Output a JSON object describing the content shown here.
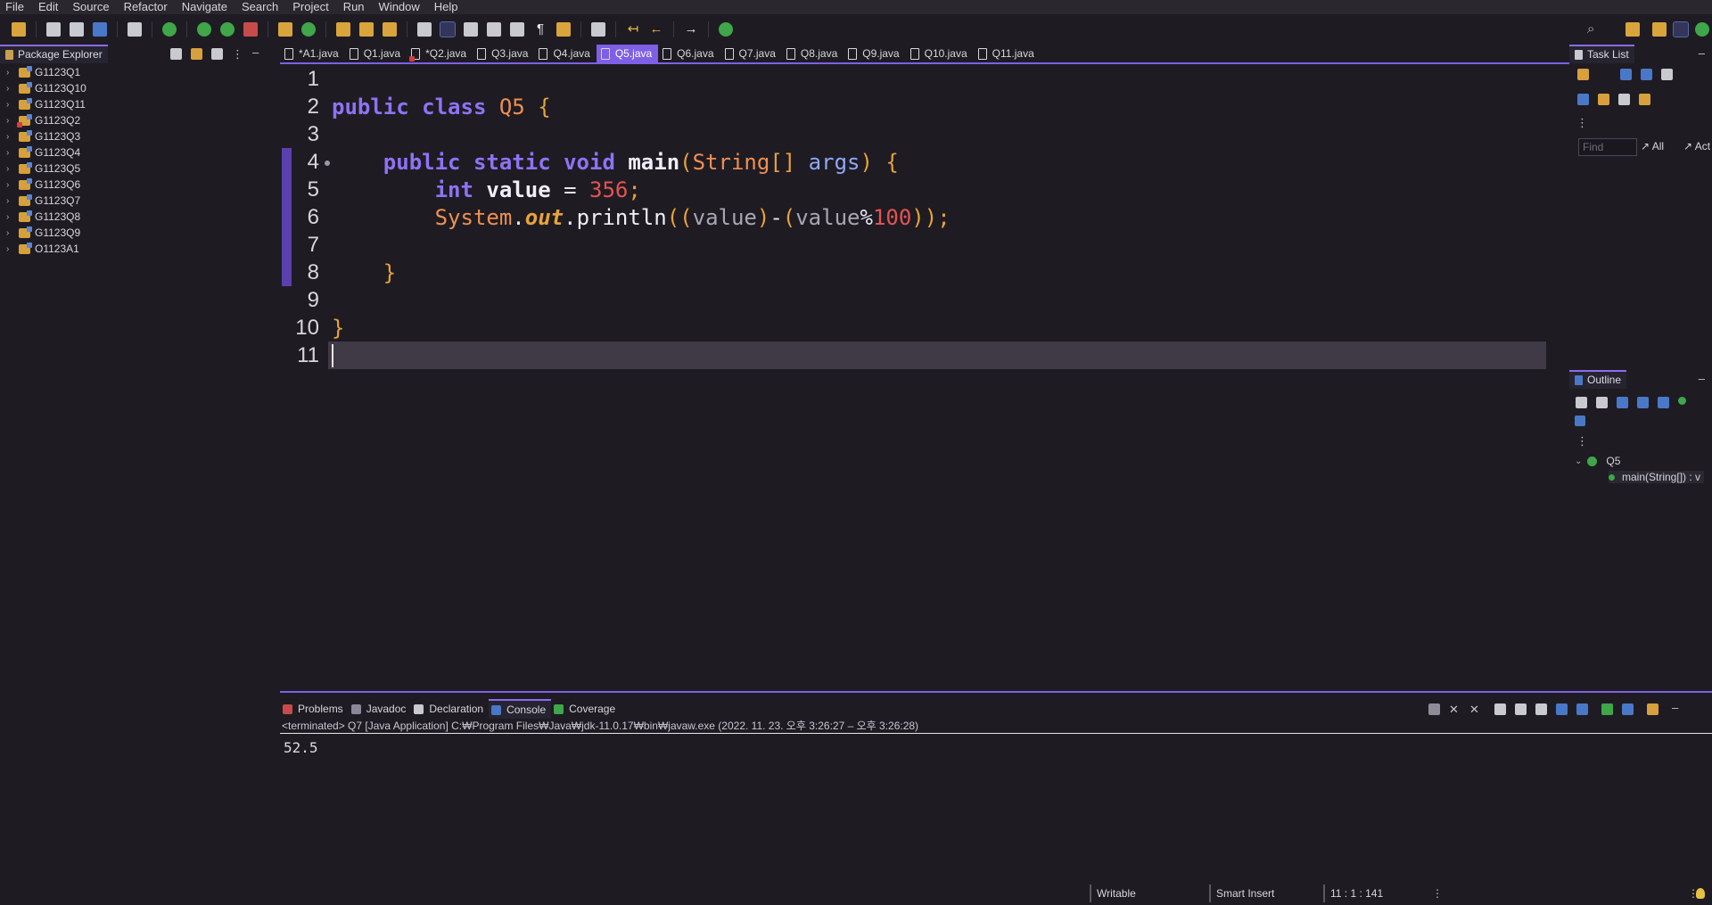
{
  "menu": [
    "File",
    "Edit",
    "Source",
    "Refactor",
    "Navigate",
    "Search",
    "Project",
    "Run",
    "Window",
    "Help"
  ],
  "package_explorer": {
    "title": "Package Explorer",
    "items": [
      {
        "label": "G1123Q1",
        "error": false
      },
      {
        "label": "G1123Q10",
        "error": false
      },
      {
        "label": "G1123Q11",
        "error": false
      },
      {
        "label": "G1123Q2",
        "error": true
      },
      {
        "label": "G1123Q3",
        "error": false
      },
      {
        "label": "G1123Q4",
        "error": false
      },
      {
        "label": "G1123Q5",
        "error": false
      },
      {
        "label": "G1123Q6",
        "error": false
      },
      {
        "label": "G1123Q7",
        "error": false
      },
      {
        "label": "G1123Q8",
        "error": false
      },
      {
        "label": "G1123Q9",
        "error": false
      },
      {
        "label": "O1123A1",
        "error": false
      }
    ]
  },
  "editor_tabs": [
    {
      "label": "*A1.java",
      "active": false,
      "error": false
    },
    {
      "label": "Q1.java",
      "active": false,
      "error": false
    },
    {
      "label": "*Q2.java",
      "active": false,
      "error": true
    },
    {
      "label": "Q3.java",
      "active": false,
      "error": false
    },
    {
      "label": "Q4.java",
      "active": false,
      "error": false
    },
    {
      "label": "Q5.java",
      "active": true,
      "error": false
    },
    {
      "label": "Q6.java",
      "active": false,
      "error": false
    },
    {
      "label": "Q7.java",
      "active": false,
      "error": false
    },
    {
      "label": "Q8.java",
      "active": false,
      "error": false
    },
    {
      "label": "Q9.java",
      "active": false,
      "error": false
    },
    {
      "label": "Q10.java",
      "active": false,
      "error": false
    },
    {
      "label": "Q11.java",
      "active": false,
      "error": false
    }
  ],
  "editor": {
    "line_numbers": [
      "1",
      "2",
      "3",
      "4",
      "5",
      "6",
      "7",
      "8",
      "9",
      "10",
      "11"
    ],
    "code": {
      "l2_kw1": "public",
      "l2_kw2": "class",
      "l2_cls": "Q5",
      "l2_br": "{",
      "l4_indent": "    ",
      "l4_kw1": "public",
      "l4_kw2": "static",
      "l4_kw3": "void",
      "l4_fn": "main",
      "l4_p1": "(",
      "l4_ty": "String",
      "l4_arr": "[]",
      "l4_pa": "args",
      "l4_p2": ")",
      "l4_br": "{",
      "l5_indent": "        ",
      "l5_ty": "int",
      "l5_var": "value",
      "l5_eq": " = ",
      "l5_num": "356",
      "l5_sc": ";",
      "l6_indent": "        ",
      "l6_sys": "System",
      "l6_dot1": ".",
      "l6_fld": "out",
      "l6_dot2": ".",
      "l6_fn": "println",
      "l6_o1": "((",
      "l6_v1": "value",
      "l6_c1": ")",
      "l6_minus": "-",
      "l6_o2": "(",
      "l6_v2": "value",
      "l6_mod": "%",
      "l6_num": "100",
      "l6_c2": "));",
      "l8_indent": "    ",
      "l8_br": "}",
      "l10_br": "}"
    }
  },
  "task_list": {
    "title": "Task List",
    "find_placeholder": "Find",
    "all_label": "All",
    "act_label": "Act"
  },
  "outline": {
    "title": "Outline",
    "class_name": "Q5",
    "method": "main(String[]) : v"
  },
  "console": {
    "tabs": [
      {
        "label": "Problems",
        "active": false
      },
      {
        "label": "Javadoc",
        "active": false
      },
      {
        "label": "Declaration",
        "active": false
      },
      {
        "label": "Console",
        "active": true
      },
      {
        "label": "Coverage",
        "active": false
      }
    ],
    "info": "<terminated> Q7 [Java Application] C:₩Program Files₩Java₩jdk-11.0.17₩bin₩javaw.exe  (2022. 11. 23. 오후 3:26:27 – 오후 3:26:28)",
    "output": "52.5"
  },
  "status": {
    "writable": "Writable",
    "insert": "Smart Insert",
    "position": "11 : 1 : 141"
  },
  "colors": {
    "accent": "#7e5fe6",
    "keyword": "#8f72f6",
    "type_orange": "#ef8f53",
    "number": "#e45353",
    "bracket": "#e8a23a"
  }
}
